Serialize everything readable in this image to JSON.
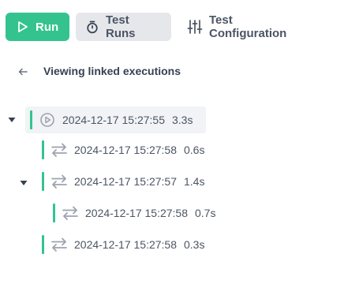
{
  "toolbar": {
    "run_label": "Run",
    "test_runs_label": "Test Runs",
    "test_configuration_label": "Test Configuration"
  },
  "header": {
    "title": "Viewing linked executions"
  },
  "executions": [
    {
      "timestamp": "2024-12-17 15:27:55",
      "duration": "3.3s",
      "icon": "play-circle-icon",
      "level": 0,
      "expanded": true,
      "selected": true
    },
    {
      "timestamp": "2024-12-17 15:27:58",
      "duration": "0.6s",
      "icon": "swap-arrows-icon",
      "level": 1,
      "expanded": false,
      "selected": false
    },
    {
      "timestamp": "2024-12-17 15:27:57",
      "duration": "1.4s",
      "icon": "swap-arrows-icon",
      "level": 1,
      "expanded": true,
      "selected": false
    },
    {
      "timestamp": "2024-12-17 15:27:58",
      "duration": "0.7s",
      "icon": "swap-arrows-icon",
      "level": 2,
      "expanded": false,
      "selected": false
    },
    {
      "timestamp": "2024-12-17 15:27:58",
      "duration": "0.3s",
      "icon": "swap-arrows-icon",
      "level": 1,
      "expanded": false,
      "selected": false
    }
  ],
  "colors": {
    "accent": "#34c38f",
    "icon_gray": "#9ca3af"
  }
}
